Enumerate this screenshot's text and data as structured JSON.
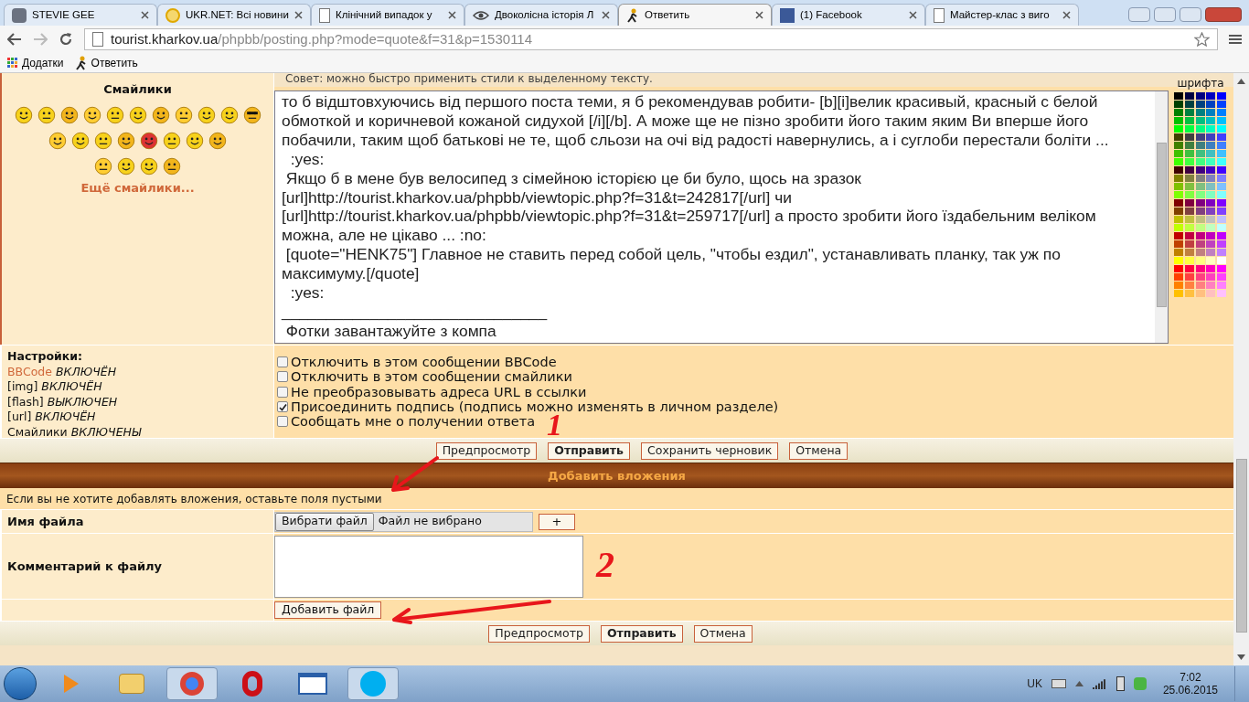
{
  "browser": {
    "tabs": [
      {
        "title": "STEVIE GEE",
        "selected": false
      },
      {
        "title": "UKR.NET: Всі новини",
        "selected": false
      },
      {
        "title": "Клінічний випадок у",
        "selected": false
      },
      {
        "title": "Двоколісна історія Л",
        "selected": false
      },
      {
        "title": "Ответить",
        "selected": true
      },
      {
        "title": "(1) Facebook",
        "selected": false
      },
      {
        "title": "Майстер-клас з виго",
        "selected": false
      }
    ],
    "address": {
      "host": "tourist.kharkov.ua",
      "path": "/phpbb/posting.php?mode=quote&f=31&p=1530114"
    },
    "bookmarks": [
      {
        "label": "Додатки"
      },
      {
        "label": "Ответить"
      }
    ]
  },
  "editor": {
    "hint": "Совет: можно быстро применить стили к выделенному тексту.",
    "smilies_title": "Смайлики",
    "more_smilies": "Ещё смайлики...",
    "palette_label": "шрифта",
    "message_lines": [
      "то б відштовхуючись від першого поста теми, я б рекомендував робити- [b][i]велик красивый, красный с белой",
      "обмоткой и коричневой кожаной сидухой [/i][/b]. А може ще не пізно зробити його таким яким Ви вперше його",
      "побачили, таким щоб батькові не те, щоб сльози на очі від радості навернулись, а і суглоби перестали боліти ...",
      "  :yes:",
      " Якщо б в мене був велосипед з сімейною історією це би було, щось на зразок",
      "[url]http://tourist.kharkov.ua/phpbb/viewtopic.php?f=31&t=242817[/url] чи",
      "[url]http://tourist.kharkov.ua/phpbb/viewtopic.php?f=31&t=259717[/url] а просто зробити його їздабельним веліком",
      "можна, але не цікаво ... :no:",
      " [quote=\"HENK75\"] Главное не ставить перед собой цель, \"чтобы ездил\", устанавливать планку, так уж по",
      "максимуму.[/quote]",
      "  :yes:",
      "______________________________",
      " Фотки завантажуйте з компа"
    ]
  },
  "settings": {
    "title": "Настройки:",
    "items": [
      {
        "name": "BBCode",
        "value": "ВКЛЮЧЁН",
        "link": true
      },
      {
        "name": "[img]",
        "value": "ВКЛЮЧЁН",
        "link": false
      },
      {
        "name": "[flash]",
        "value": "ВЫКЛЮЧЕН",
        "link": false
      },
      {
        "name": "[url]",
        "value": "ВКЛЮЧЁН",
        "link": false
      },
      {
        "name": "Смайлики",
        "value": "ВКЛЮЧЕНЫ",
        "link": false
      }
    ]
  },
  "options": [
    {
      "label": "Отключить в этом сообщении BBCode",
      "checked": false
    },
    {
      "label": "Отключить в этом сообщении смайлики",
      "checked": false
    },
    {
      "label": "Не преобразовывать адреса URL в ссылки",
      "checked": false
    },
    {
      "label": "Присоединить подпись (подпись можно изменять в личном разделе)",
      "checked": true
    },
    {
      "label": "Сообщать мне о получении ответа",
      "checked": false
    }
  ],
  "buttons": [
    {
      "label": "Предпросмотр",
      "primary": false
    },
    {
      "label": "Отправить",
      "primary": true
    },
    {
      "label": "Сохранить черновик",
      "primary": false
    },
    {
      "label": "Отмена",
      "primary": false
    }
  ],
  "attachments": {
    "title": "Добавить вложения",
    "note": "Если вы не хотите добавлять вложения, оставьте поля пустыми",
    "file_label": "Имя файла",
    "choose_button": "Вибрати файл",
    "no_file": "Файл не вибрано",
    "plus_button": "+",
    "comment_label": "Комментарий к файлу",
    "add_button": "Добавить файл",
    "buttons": [
      {
        "label": "Предпросмотр",
        "primary": false
      },
      {
        "label": "Отправить",
        "primary": true
      },
      {
        "label": "Отмена",
        "primary": false
      }
    ]
  },
  "annotations": [
    {
      "label": "1"
    },
    {
      "label": "2"
    }
  ],
  "taskbar": {
    "language": "UK",
    "time": "7:02",
    "date": "25.06.2015"
  }
}
